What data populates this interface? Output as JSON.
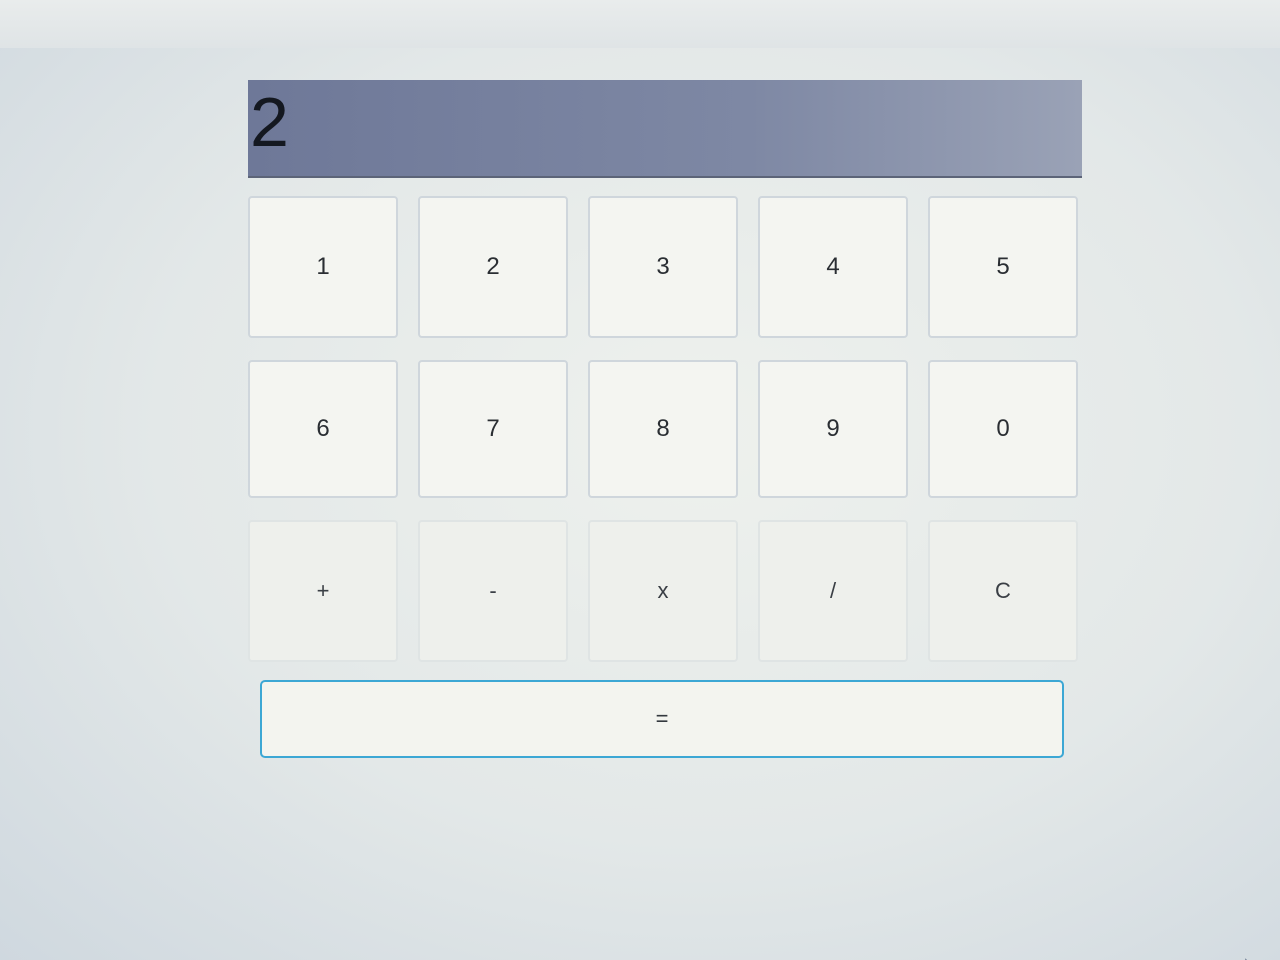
{
  "display": {
    "value": "2"
  },
  "keys": [
    {
      "label": "1",
      "name": "key-1"
    },
    {
      "label": "2",
      "name": "key-2"
    },
    {
      "label": "3",
      "name": "key-3"
    },
    {
      "label": "4",
      "name": "key-4"
    },
    {
      "label": "5",
      "name": "key-5"
    },
    {
      "label": "6",
      "name": "key-6"
    },
    {
      "label": "7",
      "name": "key-7"
    },
    {
      "label": "8",
      "name": "key-8"
    },
    {
      "label": "9",
      "name": "key-9"
    },
    {
      "label": "0",
      "name": "key-0"
    },
    {
      "label": "+",
      "name": "add-button"
    },
    {
      "label": "-",
      "name": "subtract-button"
    },
    {
      "label": "x",
      "name": "multiply-button"
    },
    {
      "label": "/",
      "name": "divide-button"
    },
    {
      "label": "C",
      "name": "clear-button"
    }
  ],
  "equals": {
    "label": "="
  },
  "colors": {
    "display_bg": "#7e88a4",
    "equals_border": "#3ca7d4",
    "key_bg": "#f4f5f1"
  },
  "icons": {
    "cursor": "mouse-pointer-icon"
  }
}
